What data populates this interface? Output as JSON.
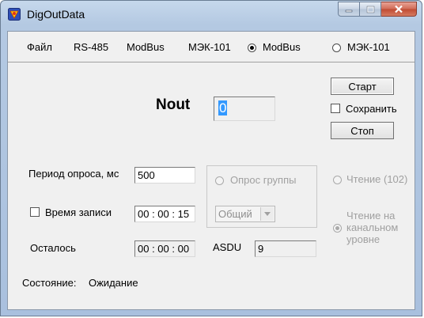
{
  "window": {
    "title": "DigOutData"
  },
  "menu": {
    "file": "Файл",
    "rs485": "RS-485",
    "modbus": "ModBus",
    "iec101": "МЭК-101",
    "mode_radio_1": {
      "label": "ModBus",
      "checked": true
    },
    "mode_radio_2": {
      "label": "МЭК-101",
      "checked": false
    }
  },
  "main": {
    "nout_label": "Nout",
    "nout_value": "0",
    "start_button": "Старт",
    "save_checkbox": {
      "label": "Сохранить",
      "checked": false
    },
    "stop_button": "Стоп",
    "poll_period_label": "Период опроса, мс",
    "poll_period_value": "500",
    "group_poll_radio": {
      "label": "Опрос группы",
      "checked": false,
      "enabled": false
    },
    "group_combo_value": "Общий",
    "read_radio": {
      "label": "Чтение (102)",
      "checked": false,
      "enabled": false
    },
    "record_time_checkbox": {
      "label": "Время записи",
      "checked": false
    },
    "record_time_value": "00 : 00 : 15",
    "channel_read_radio": {
      "label_line1": "Чтение на",
      "label_line2": "канальном",
      "label_line3": "уровне",
      "checked": true,
      "enabled": false
    },
    "remaining_label": "Осталось",
    "remaining_value": "00 : 00 : 00",
    "asdu_label": "ASDU",
    "asdu_value": "9",
    "status_label": "Состояние:",
    "status_value": "Ожидание"
  }
}
